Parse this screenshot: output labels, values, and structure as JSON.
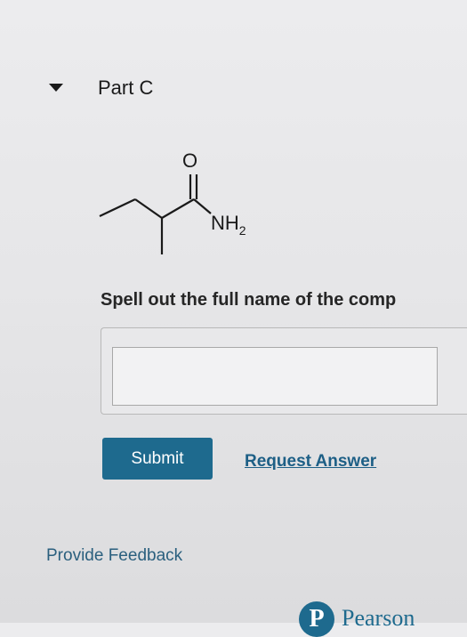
{
  "section": {
    "title": "Part C",
    "caret_icon": "caret-down-icon"
  },
  "molecule": {
    "oxygen_label": "O",
    "amine_label": "NH",
    "amine_subscript": "2"
  },
  "question": {
    "text": "Spell out the full name of the comp"
  },
  "answer": {
    "value": "",
    "placeholder": ""
  },
  "actions": {
    "submit_label": "Submit",
    "request_answer_label": "Request Answer"
  },
  "footer": {
    "feedback_label": "Provide Feedback",
    "brand_text": "Pearson",
    "brand_icon": "pearson-logo-icon"
  },
  "colors": {
    "accent": "#1e6a8e",
    "link": "#1d5f86",
    "background": "#e8e8ea"
  }
}
